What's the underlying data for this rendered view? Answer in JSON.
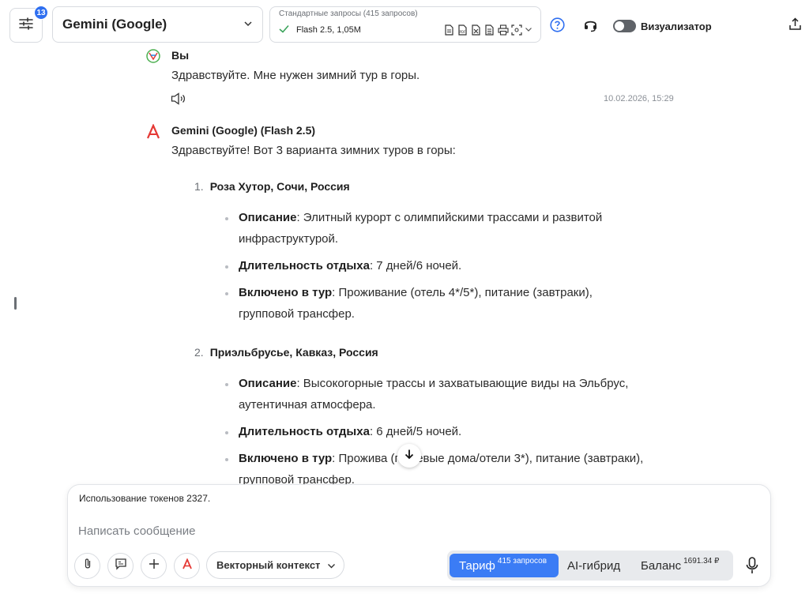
{
  "header": {
    "settings_badge": "13",
    "model_name": "Gemini (Google)",
    "plan_group": "Стандартные запросы (415 запросов)",
    "plan_selected": "Flash 2.5, 1,05M",
    "visualizer_label": "Визуализатор",
    "visualizer_on": false,
    "accent_color": "#2f6ff0"
  },
  "chat": {
    "user_author": "Вы",
    "user_message": "Здравствуйте. Мне нужен зимний тур в горы.",
    "user_timestamp": "10.02.2026, 15:29",
    "bot_author": "Gemini (Google) (Flash 2.5)",
    "bot_intro": "Здравствуйте! Вот 3 варианта зимних туров в горы:",
    "sections": [
      {
        "num": "1.",
        "title": "Роза Хутор, Сочи, Россия",
        "bullets": [
          {
            "label": "Описание",
            "text": ": Элитный курорт с олимпийскими трассами и развитой инфраструктурой."
          },
          {
            "label": "Длительность отдыха",
            "text": ": 7 дней/6 ночей."
          },
          {
            "label": "Включено в тур",
            "text": ": Проживание (отель 4*/5*), питание (завтраки), групповой трансфер."
          }
        ]
      },
      {
        "num": "2.",
        "title": "Приэльбрусье, Кавказ, Россия",
        "bullets": [
          {
            "label": "Описание",
            "text": ": Высокогорные трассы и захватывающие виды на Эльбрус, аутентичная атмосфера."
          },
          {
            "label": "Длительность отдыха",
            "text": ": 6 дней/5 ночей."
          },
          {
            "label": "Включено в тур",
            "text": ": Прожива   (гостевые дома/отели 3*), питание (завтраки), групповой трансфер."
          }
        ]
      }
    ]
  },
  "composer": {
    "tokens_info": "Использование токенов 2327.",
    "placeholder": "Написать сообщение",
    "vector_context": "Векторный контекст",
    "tariff_label": "Тариф",
    "tariff_sup": "415 запросов",
    "ai_hybrid_label": "AI-гибрид",
    "balance_label": "Баланс",
    "balance_sup": "1691.34 ₽"
  }
}
